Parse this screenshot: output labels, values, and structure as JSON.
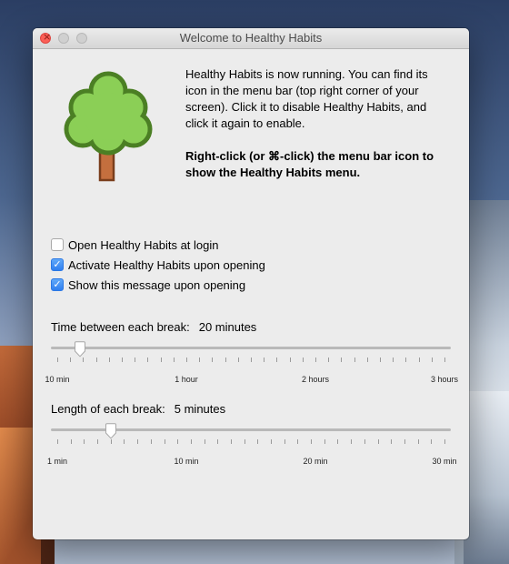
{
  "window": {
    "title": "Welcome to Healthy Habits"
  },
  "intro": {
    "paragraph1": "Healthy Habits is now running. You can find its icon in the menu bar (top right corner of your screen). Click it to disable Healthy Habits, and click it again to enable.",
    "paragraph2": "Right-click (or ⌘-click) the menu bar icon to show the Healthy Habits menu."
  },
  "options": [
    {
      "label": "Open Healthy Habits at login",
      "checked": false
    },
    {
      "label": "Activate Healthy Habits upon opening",
      "checked": true
    },
    {
      "label": "Show this message upon opening",
      "checked": true
    }
  ],
  "break_interval": {
    "label": "Time between each break:",
    "value_text": "20 minutes",
    "value_minutes": 20,
    "range_minutes": [
      10,
      180
    ],
    "tick_labels": [
      "10 min",
      "1 hour",
      "2 hours",
      "3 hours"
    ]
  },
  "break_length": {
    "label": "Length of each break:",
    "value_text": "5 minutes",
    "value_minutes": 5,
    "range_minutes": [
      1,
      30
    ],
    "tick_labels": [
      "1 min",
      "10 min",
      "20 min",
      "30 min"
    ]
  },
  "icons": {
    "app": "tree-icon"
  },
  "colors": {
    "accent": "#3b8cf5",
    "close": "#fc5f57",
    "tree_leaves": "#8bcf56",
    "tree_outline": "#4b7f24",
    "trunk": "#c46f3e"
  }
}
